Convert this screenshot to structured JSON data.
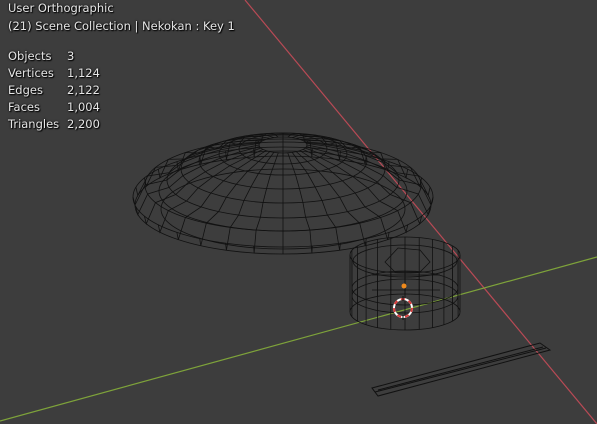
{
  "viewport": {
    "view_title": "User Orthographic",
    "collection_line": "(21) Scene Collection | Nekokan : Key 1"
  },
  "stats": [
    {
      "label": "Objects",
      "value": "3"
    },
    {
      "label": "Vertices",
      "value": "1,124"
    },
    {
      "label": "Edges",
      "value": "2,122"
    },
    {
      "label": "Faces",
      "value": "1,004"
    },
    {
      "label": "Triangles",
      "value": "2,200"
    }
  ],
  "colors": {
    "background": "#3d3d3d",
    "x_axis": "#b84a55",
    "y_axis": "#7ea33a",
    "wire": "#111111",
    "origin": "#f08a1c",
    "cursor": "#d83a3a"
  }
}
